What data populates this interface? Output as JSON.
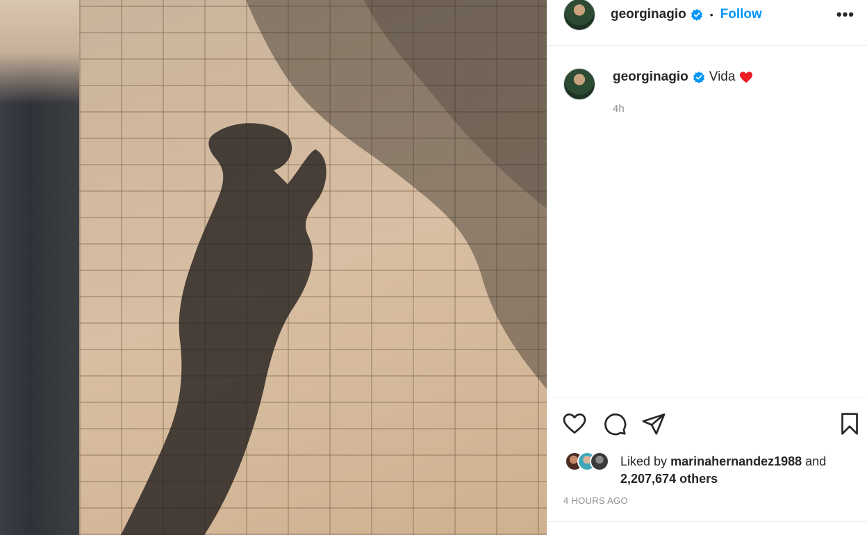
{
  "post": {
    "username": "georginagio",
    "follow_label": "Follow",
    "separator": "•",
    "more_label": "•••",
    "caption_text": "Vida",
    "caption_time": "4h",
    "liked_by_prefix": "Liked by",
    "liked_by_user": "marinahernandez1988",
    "liked_by_and": "and",
    "likes_others": "2,207,674 others",
    "posted_ago": "4 HOURS AGO"
  },
  "icons": {
    "verified": "verified-badge-icon",
    "next": "chevron-right-icon",
    "like": "heart-outline-icon",
    "comment": "comment-bubble-icon",
    "share": "paper-plane-icon",
    "save": "bookmark-icon",
    "more": "more-options-icon"
  },
  "colors": {
    "accent": "#0095f6",
    "heart": "#ed1c24",
    "muted": "#8e8e8e",
    "text": "#262626"
  }
}
